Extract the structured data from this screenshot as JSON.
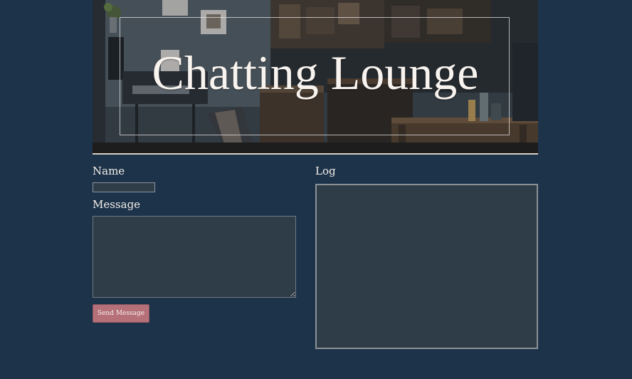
{
  "hero": {
    "title": "Chatting Lounge"
  },
  "form": {
    "name_label": "Name",
    "name_value": "",
    "message_label": "Message",
    "message_value": "",
    "send_label": "Send Message"
  },
  "log": {
    "label": "Log",
    "content": ""
  },
  "colors": {
    "page_background": "#1d334a",
    "field_background": "#2f3d48",
    "button_accent": "#b57078"
  }
}
